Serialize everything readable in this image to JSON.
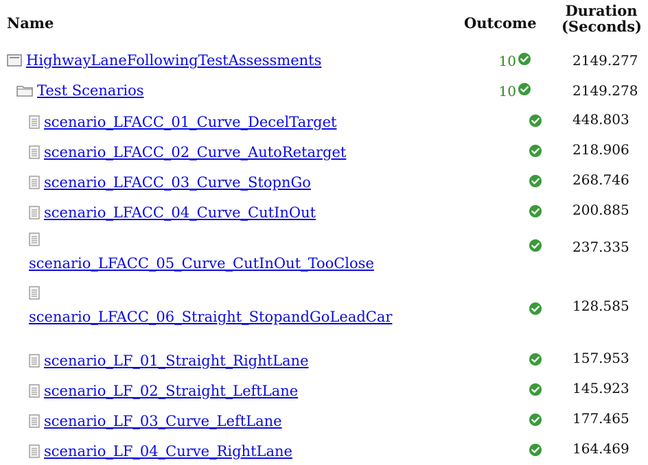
{
  "headers": {
    "name": "Name",
    "outcome": "Outcome",
    "duration_line1": "Duration",
    "duration_line2": "(Seconds)"
  },
  "colors": {
    "pass": "#3a9a3a",
    "link": "#0b0be0",
    "count": "#2f8a1f"
  },
  "root": {
    "label": "HighwayLaneFollowingTestAssessments",
    "count": "10",
    "duration": "2149.277",
    "icon": "collapse-box-icon"
  },
  "folder": {
    "label": "Test Scenarios",
    "count": "10",
    "duration": "2149.278",
    "icon": "folder-icon"
  },
  "scenarios": [
    {
      "label": "scenario_LFACC_01_Curve_DecelTarget",
      "duration": "448.803"
    },
    {
      "label": "scenario_LFACC_02_Curve_AutoRetarget",
      "duration": "218.906"
    },
    {
      "label": "scenario_LFACC_03_Curve_StopnGo",
      "duration": "268.746"
    },
    {
      "label": "scenario_LFACC_04_Curve_CutInOut",
      "duration": "200.885"
    },
    {
      "label": "scenario_LFACC_05_Curve_CutInOut_TooClose",
      "duration": "237.335"
    },
    {
      "label": "scenario_LFACC_06_Straight_StopandGoLeadCar",
      "duration": "128.585"
    },
    {
      "label": "scenario_LF_01_Straight_RightLane",
      "duration": "157.953"
    },
    {
      "label": "scenario_LF_02_Straight_LeftLane",
      "duration": "145.923"
    },
    {
      "label": "scenario_LF_03_Curve_LeftLane",
      "duration": "177.465"
    },
    {
      "label": "scenario_LF_04_Curve_RightLane",
      "duration": "164.469"
    }
  ]
}
